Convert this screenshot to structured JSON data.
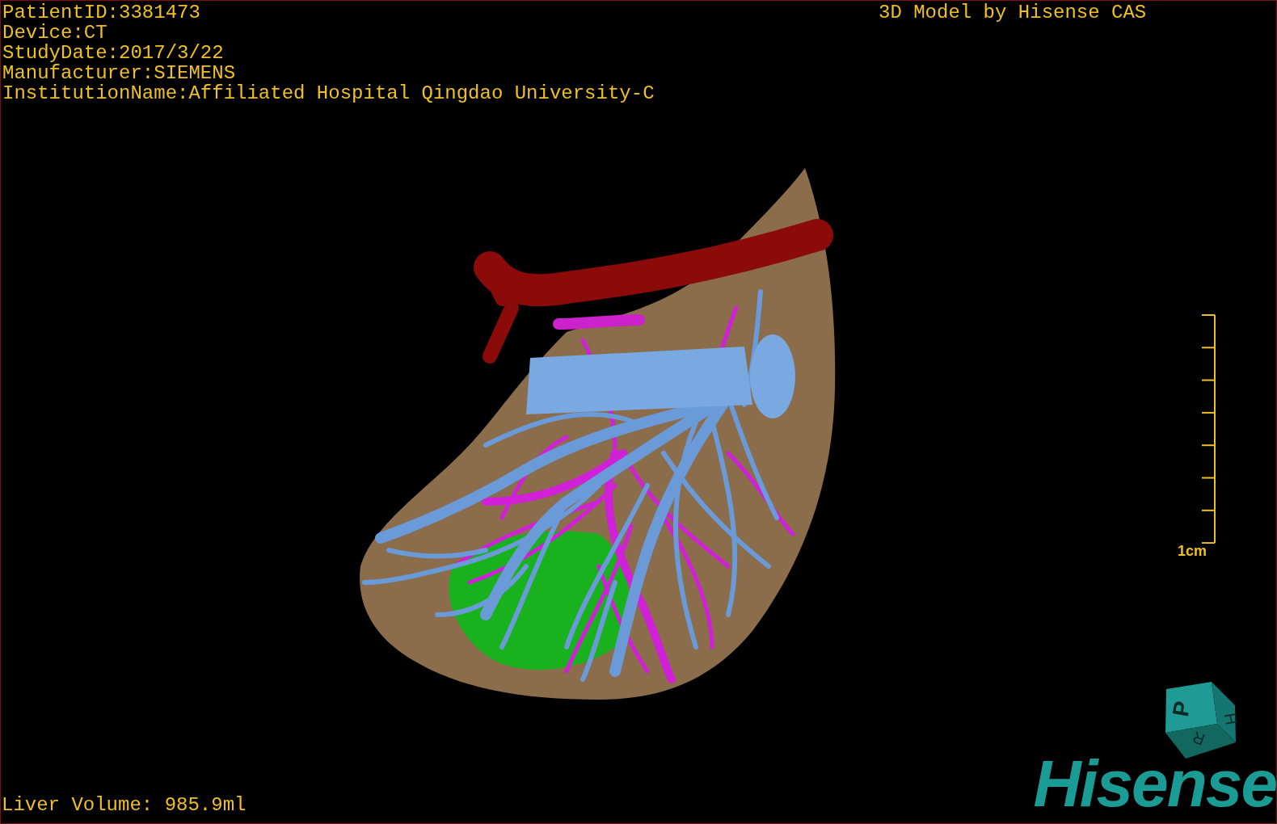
{
  "patient_info": [
    "PatientID:3381473",
    "Device:CT",
    "StudyDate:2017/3/22",
    "Manufacturer:SIEMENS",
    "InstitutionName:Affiliated Hospital Qingdao University-C"
  ],
  "title": "3D Model by Hisense CAS",
  "scale_bar": {
    "label": "1cm"
  },
  "orientation_cube": {
    "faces": [
      "P",
      "H",
      "R"
    ]
  },
  "logo": "Hisense",
  "liver_volume": "Liver Volume: 985.9ml"
}
